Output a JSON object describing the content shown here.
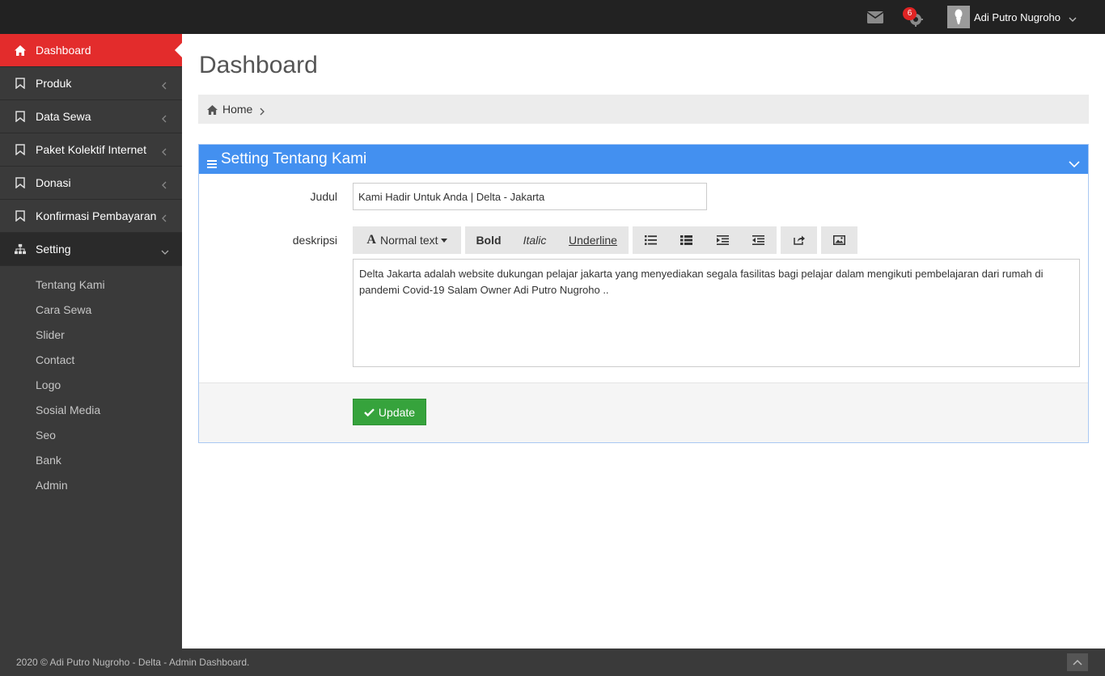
{
  "topbar": {
    "notification_count": "6",
    "user_name": "Adi Putro Nugroho"
  },
  "sidebar": {
    "items": [
      {
        "label": "Dashboard",
        "icon": "home-icon"
      },
      {
        "label": "Produk",
        "icon": "bookmark-icon"
      },
      {
        "label": "Data Sewa",
        "icon": "bookmark-icon"
      },
      {
        "label": "Paket Kolektif Internet",
        "icon": "bookmark-icon"
      },
      {
        "label": "Donasi",
        "icon": "bookmark-icon"
      },
      {
        "label": "Konfirmasi Pembayaran",
        "icon": "bookmark-icon"
      },
      {
        "label": "Setting",
        "icon": "sitemap-icon"
      }
    ],
    "submenu": [
      "Tentang Kami",
      "Cara Sewa",
      "Slider",
      "Contact",
      "Logo",
      "Sosial Media",
      "Seo",
      "Bank",
      "Admin"
    ]
  },
  "main": {
    "title": "Dashboard",
    "breadcrumb": {
      "home": "Home"
    },
    "panel": {
      "title": "Setting Tentang Kami",
      "judul_label": "Judul",
      "judul_value": "Kami Hadir Untuk Anda | Delta - Jakarta",
      "deskripsi_label": "deskripsi",
      "toolbar": {
        "normal_text": "Normal text",
        "bold": "Bold",
        "italic": "Italic",
        "underline": "Underline"
      },
      "deskripsi_value": "Delta Jakarta adalah website dukungan pelajar jakarta yang menyediakan segala fasilitas bagi pelajar dalam mengikuti pembelajaran dari rumah di pandemi Covid-19 Salam Owner Adi Putro Nugroho ..",
      "update_label": "Update"
    }
  },
  "footer": {
    "copyright": "2020 © Adi Putro Nugroho - Delta - Admin Dashboard."
  },
  "colors": {
    "topbar": "#222222",
    "sidebar": "#3a3a3a",
    "active": "#e32c2c",
    "panel_header": "#4390f0",
    "update_button": "#36a33c"
  }
}
